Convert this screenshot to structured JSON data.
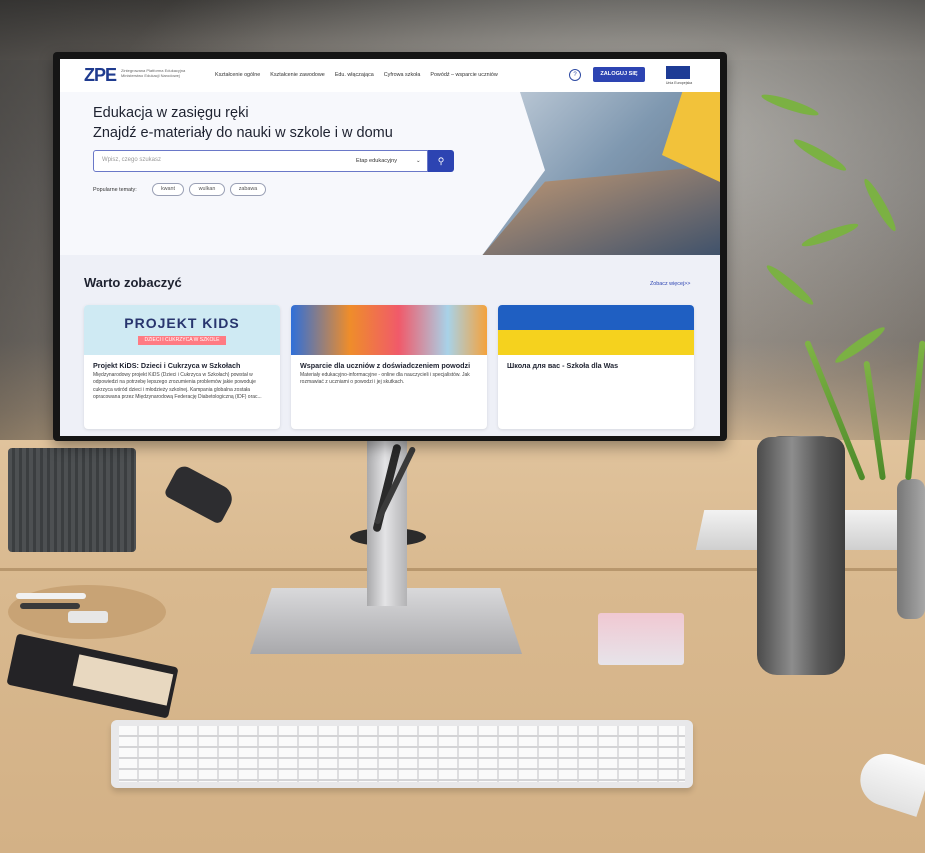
{
  "site": {
    "logo_text": "ZPE",
    "logo_subtitle": "Zintegrowana Platforma Edukacyjna Ministerstwo Edukacji Narodowej",
    "nav_links": [
      "Kształcenie ogólne",
      "Kształcenie zawodowe",
      "Edu. włączająca",
      "Cyfrowa szkoła",
      "Powódź – wsparcie uczniów"
    ],
    "help_symbol": "?",
    "login_label": "ZALOGUJ SIĘ",
    "eu_label": "Unia Europejska"
  },
  "hero": {
    "line1": "Edukacja w zasięgu ręki",
    "line2": "Znajdź e-materiały do nauki w szkole i w domu",
    "search_placeholder": "Wpisz, czego szukasz",
    "stage_label": "Etap edukacyjny",
    "popular_label": "Popularne tematy:",
    "topics": [
      "kwant",
      "wulkan",
      "zabawa"
    ]
  },
  "section": {
    "title": "Warto zobaczyć",
    "more_link": "Zobacz więcej>>",
    "cards": [
      {
        "image_word": "PROJEKT KIDS",
        "image_sub": "DZIECI I CUKRZYCA W SZKOLE",
        "title": "Projekt KiDS: Dzieci i Cukrzyca w Szkołach",
        "desc": "Międzynarodowy projekt KiDS (Dzieci i Cukrzyca w Szkołach) powstał w odpowiedzi na potrzebę lepszego zrozumienia problemów jakie powoduje cukrzyca wśród dzieci i młodzieży szkolnej. Kampania globalna została opracowana przez Międzynarodową Federację Diabetologiczną (IDF) orac..."
      },
      {
        "title": "Wsparcie dla uczniów z doświadczeniem powodzi",
        "desc": "Materiały edukacyjno-informacyjne - online dla nauczycieli i specjalistów. Jak rozmawiać z uczniami o powodzi i jej skutkach."
      },
      {
        "title": "Школа для вас - Szkoła dla Was",
        "desc": ""
      }
    ]
  },
  "icons": {
    "search": "search-icon",
    "help": "help-icon",
    "chevron": "chevron-down-icon",
    "flag": "eu-flag-icon"
  },
  "colors": {
    "brand_blue": "#2d44b2",
    "accent_yellow": "#f2c23a"
  }
}
